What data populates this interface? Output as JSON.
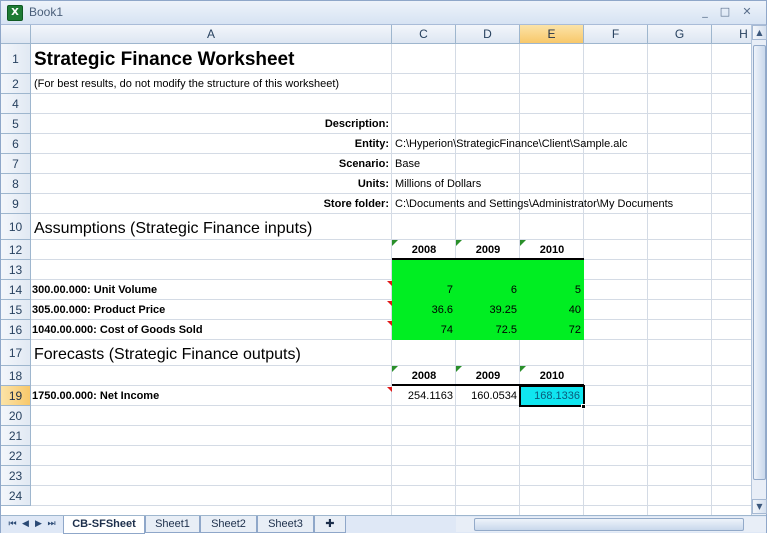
{
  "window": {
    "title": "Book1",
    "app_icon": "excel-icon",
    "controls": {
      "minimize": "_",
      "restore": "□",
      "close": "✕"
    }
  },
  "columns": [
    "A",
    "C",
    "D",
    "E",
    "F",
    "G",
    "H"
  ],
  "selected_column": "E",
  "rows": [
    "1",
    "2",
    "4",
    "5",
    "6",
    "7",
    "8",
    "9",
    "10",
    "12",
    "13",
    "14",
    "15",
    "16",
    "17",
    "18",
    "19",
    "20",
    "21",
    "22",
    "23",
    "24"
  ],
  "selected_row": "19",
  "sheet": {
    "title": "Strategic Finance Worksheet",
    "note": "(For best results, do not modify the structure of this worksheet)",
    "meta": [
      {
        "label": "Description:",
        "value": ""
      },
      {
        "label": "Entity:",
        "value": "C:\\Hyperion\\StrategicFinance\\Client\\Sample.alc"
      },
      {
        "label": "Scenario:",
        "value": "Base"
      },
      {
        "label": "Units:",
        "value": "Millions of Dollars"
      },
      {
        "label": "Store folder:",
        "value": "C:\\Documents and Settings\\Administrator\\My Documents"
      }
    ],
    "assumptions": {
      "heading": "Assumptions (Strategic Finance inputs)",
      "years": [
        "2008",
        "2009",
        "2010"
      ],
      "rows": [
        {
          "label": "300.00.000: Unit Volume",
          "values": [
            "7",
            "6",
            "5"
          ]
        },
        {
          "label": "305.00.000: Product Price",
          "values": [
            "36.6",
            "39.25",
            "40"
          ]
        },
        {
          "label": "1040.00.000: Cost of Goods Sold",
          "values": [
            "74",
            "72.5",
            "72"
          ]
        }
      ]
    },
    "forecasts": {
      "heading": "Forecasts (Strategic Finance outputs)",
      "years": [
        "2008",
        "2009",
        "2010"
      ],
      "rows": [
        {
          "label": "1750.00.000: Net Income",
          "values": [
            "254.1163",
            "160.0534",
            "168.1336"
          ]
        }
      ]
    }
  },
  "tabs": {
    "nav": [
      "⏮",
      "◀",
      "▶",
      "⏭"
    ],
    "sheets": [
      "CB-SFSheet",
      "Sheet1",
      "Sheet2",
      "Sheet3"
    ],
    "active": "CB-SFSheet",
    "insert_icon": "insert-sheet-icon"
  },
  "colors": {
    "input_fill": "#00ff00",
    "selected_fill": "#10e6f0",
    "comment_marker": "#e01818"
  }
}
